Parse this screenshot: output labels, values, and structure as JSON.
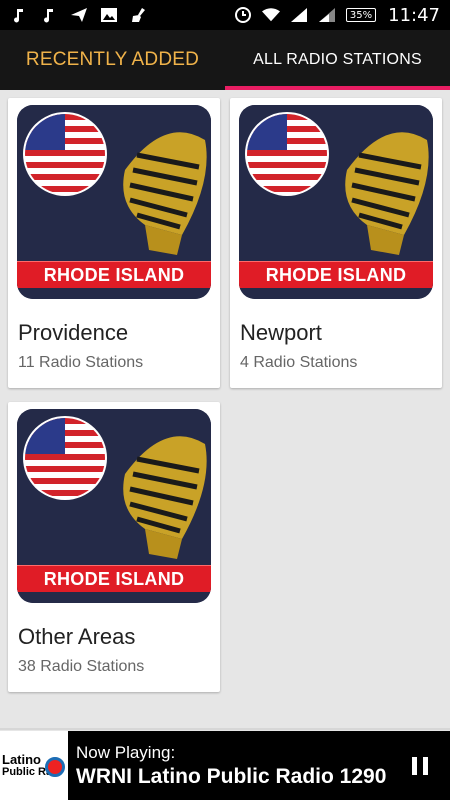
{
  "status_bar": {
    "battery": "35%",
    "time": "11:47",
    "icons": [
      "music-note-icon",
      "music-note-icon",
      "tiktok-like-icon",
      "image-icon",
      "broom-icon",
      "alarm-icon",
      "wifi-icon",
      "signal-icon",
      "signal-icon"
    ]
  },
  "tabs": [
    {
      "label": "RECENTLY ADDED",
      "active": false,
      "color": "#f0b34a"
    },
    {
      "label": "ALL RADIO STATIONS",
      "active": true,
      "color": "#ffffff"
    }
  ],
  "cards": [
    {
      "title": "Providence",
      "subtitle": "11 Radio Stations",
      "banner": "RHODE ISLAND"
    },
    {
      "title": "Newport",
      "subtitle": "4 Radio Stations",
      "banner": "RHODE ISLAND"
    },
    {
      "title": "Other Areas",
      "subtitle": "38 Radio Stations",
      "banner": "RHODE ISLAND"
    }
  ],
  "player": {
    "logo_line1": "Latino",
    "logo_line2": "Public Radi",
    "now_playing_label": "Now Playing:",
    "station": "WRNI Latino Public Radio 1290"
  },
  "colors": {
    "accent": "#e91e63",
    "recent_tab": "#f0b34a",
    "banner": "#e01c26",
    "card_bg": "#242a48"
  }
}
